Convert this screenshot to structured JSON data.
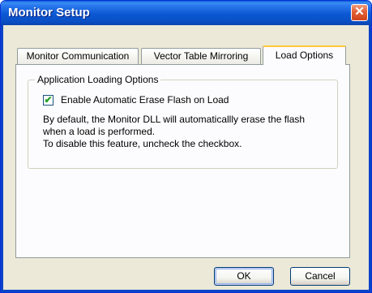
{
  "window": {
    "title": "Monitor Setup",
    "close_glyph": "✕"
  },
  "tabs": [
    {
      "label": "Monitor Communication",
      "active": false
    },
    {
      "label": "Vector Table Mirroring",
      "active": false
    },
    {
      "label": "Load Options",
      "active": true
    }
  ],
  "load_options": {
    "group_label": "Application Loading Options",
    "checkbox": {
      "label": "Enable Automatic Erase Flash on Load",
      "checked": true,
      "glyph": "✔"
    },
    "description": [
      "By default, the Monitor DLL will automaticallly erase the flash",
      "when a load is performed.",
      "To disable this feature, uncheck the checkbox."
    ]
  },
  "buttons": {
    "ok": "OK",
    "cancel": "Cancel"
  },
  "colors": {
    "titlebar": "#0a4fc4",
    "close": "#d0431a",
    "dialog_bg": "#ece9d8",
    "active_tab_highlight": "#ffc83c"
  }
}
